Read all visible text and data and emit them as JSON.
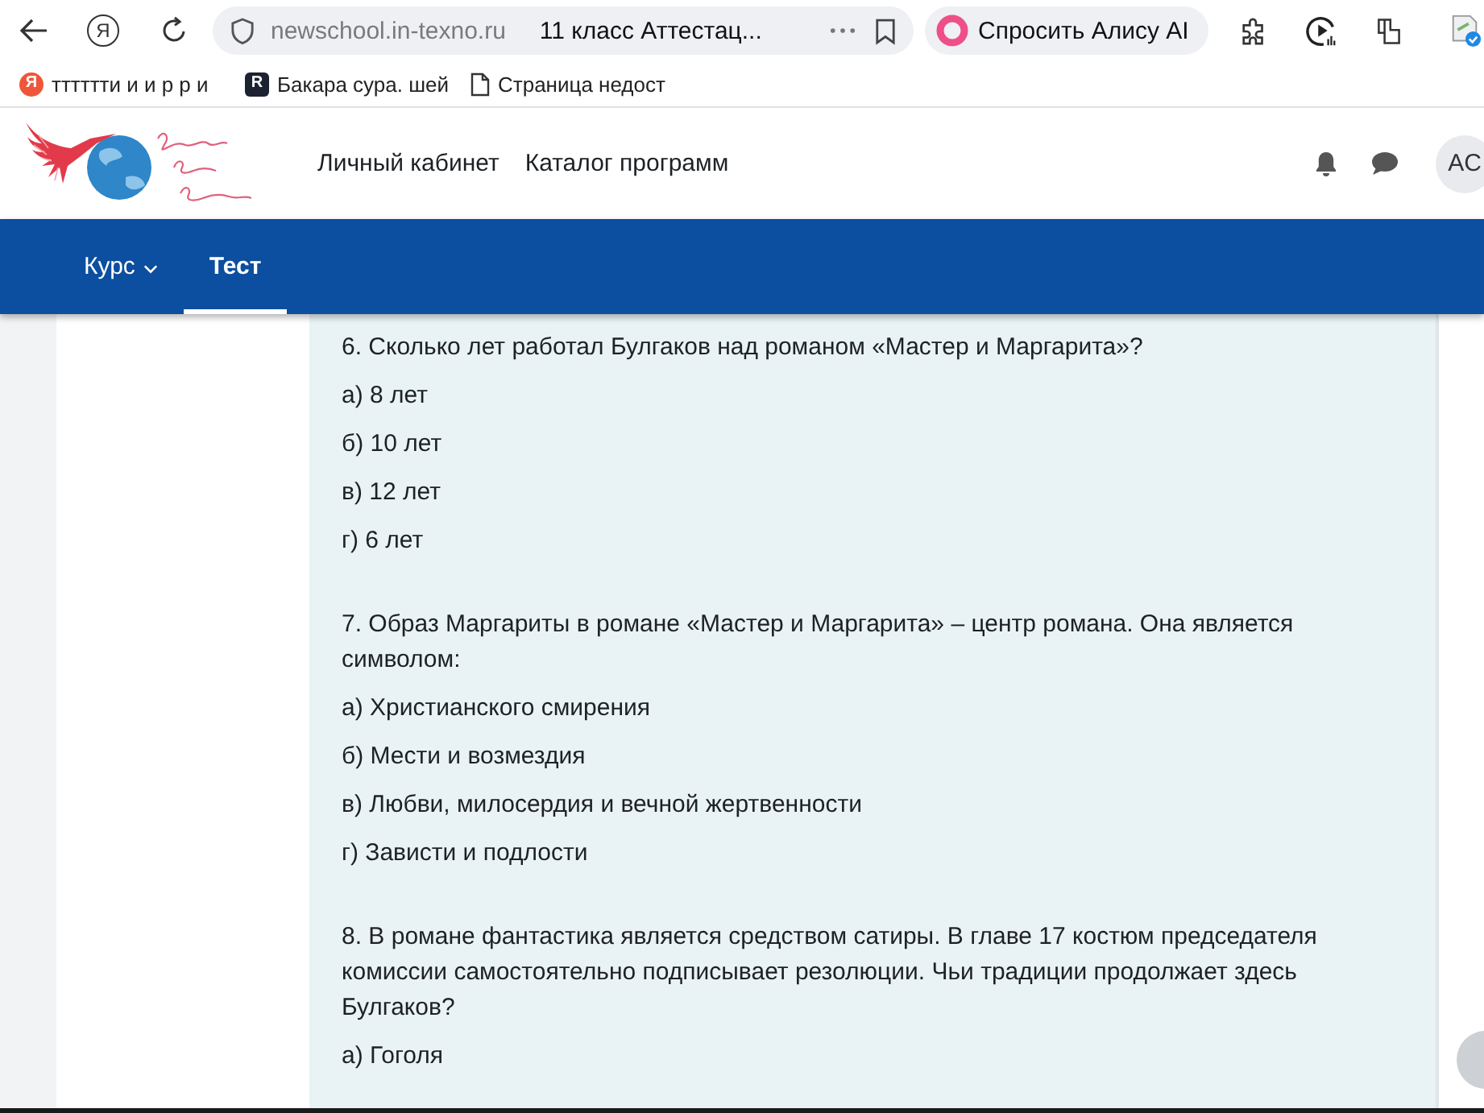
{
  "browser": {
    "home_button": "Я",
    "url": "newschool.in-texno.ru",
    "tab_title": "11 класс Аттестац...",
    "alice_button": "Спросить Алису AI"
  },
  "bookmarks": [
    {
      "kind": "circle",
      "badge": "Я",
      "label": "тттттти и и р р и"
    },
    {
      "kind": "tile",
      "badge": "R",
      "label": "Бакара сура. шей"
    },
    {
      "kind": "page",
      "label": "Страница недост"
    }
  ],
  "site_header": {
    "nav": [
      "Личный кабинет",
      "Каталог программ"
    ],
    "avatar": "AC"
  },
  "course_nav": {
    "tabs": [
      {
        "label": "Курс",
        "dropdown": true,
        "selected": false
      },
      {
        "label": "Тест",
        "dropdown": false,
        "selected": true
      }
    ]
  },
  "questions": [
    {
      "text": "6. Сколько лет работал Булгаков над романом «Мастер и Маргарита»?",
      "answers": [
        "а) 8 лет",
        "б) 10 лет",
        "в) 12 лет",
        "г) 6 лет"
      ]
    },
    {
      "text": "7. Образ Маргариты в романе «Мастер и Маргарита» – центр романа. Она является символом:",
      "answers": [
        "а) Христианского смирения",
        "б) Мести и возмездия",
        "в) Любви, милосердия и вечной жертвенности",
        "г) Зависти и подлости"
      ]
    },
    {
      "text": "8. В романе фантастика является средством сатиры. В главе 17 костюм председателя комиссии самостоятельно подписывает резолюции. Чьи традиции продолжает здесь Булгаков?",
      "answers": [
        "а) Гоголя"
      ]
    }
  ]
}
